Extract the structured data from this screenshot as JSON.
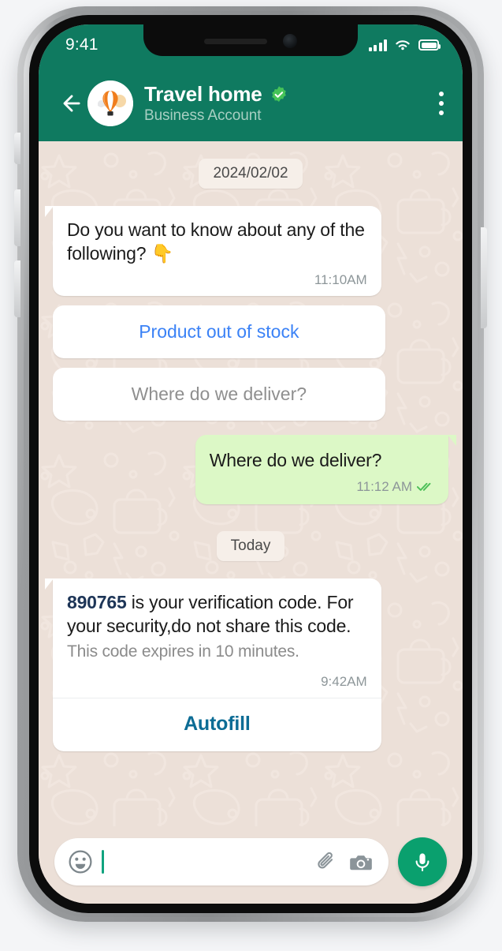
{
  "status_bar": {
    "time": "9:41",
    "signal_icon": "signal-bars-icon",
    "wifi_icon": "wifi-icon",
    "battery_icon": "battery-full-icon"
  },
  "chat_header": {
    "back_icon": "back-arrow-icon",
    "avatar_icon": "hot-air-balloon-avatar",
    "title": "Travel home",
    "verified_icon": "verified-badge-icon",
    "subtitle": "Business Account",
    "menu_icon": "overflow-menu-icon",
    "background_color": "#0f7a60"
  },
  "conversation": {
    "date_divider_1": "2024/02/02",
    "date_divider_2": "Today",
    "message_1": {
      "text": "Do you want to know about any of the following? 👇",
      "time": "11:10AM"
    },
    "quick_reply_1": "Product out of stock",
    "quick_reply_2": "Where do we deliver?",
    "message_out": {
      "text": "Where do we deliver?",
      "time": "11:12 AM",
      "status_icon": "double-check-read-icon"
    },
    "verification_message": {
      "code": "890765",
      "text_after_code": " is your verification code. For your security,do not share this code.",
      "expiry_note": "This code expires in 10 minutes.",
      "time": "9:42AM",
      "action_label": "Autofill"
    }
  },
  "input_bar": {
    "emoji_icon": "emoji-smiley-icon",
    "message_value": "",
    "placeholder": "",
    "attach_icon": "paperclip-icon",
    "camera_icon": "camera-icon",
    "mic_icon": "microphone-icon"
  },
  "colors": {
    "header_green": "#0f7a60",
    "wallpaper": "#ece0d8",
    "outgoing_bubble": "#dcf8c6",
    "incoming_bubble": "#ffffff",
    "link_blue": "#3b82f6",
    "autofill_blue": "#0c6c95",
    "mic_green": "#0aa06e",
    "code_navy": "#1d3557"
  }
}
